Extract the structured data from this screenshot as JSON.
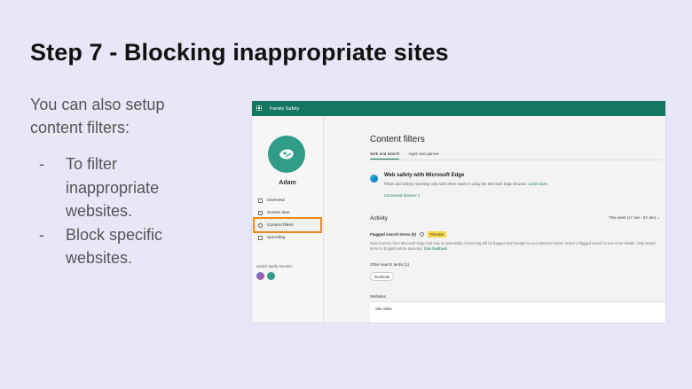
{
  "slide": {
    "title": "Step 7 - Blocking inappropriate sites",
    "intro": "You can also setup content filters:",
    "bullets": [
      {
        "dash": "-",
        "text": "To filter inappropriate websites."
      },
      {
        "dash": "-",
        "text": "Block specific websites."
      }
    ]
  },
  "app": {
    "title": "Family Safety",
    "accent_color": "#13785f",
    "highlight_color": "#f08a1a",
    "user": {
      "name": "Adam"
    },
    "nav": [
      {
        "label": "Overview",
        "icon": "overview-icon"
      },
      {
        "label": "Screen time",
        "icon": "screen-time-icon"
      },
      {
        "label": "Content filters",
        "icon": "content-filter-icon"
      },
      {
        "label": "Spending",
        "icon": "spending-icon"
      }
    ],
    "switch_label": "Switch family member"
  },
  "content": {
    "title": "Content filters",
    "tabs": [
      "Web and search",
      "Apps and games"
    ],
    "web_safety": {
      "title": "Web safety with Microsoft Edge",
      "desc": "Filters and activity reporting only work when Adam is using the Microsoft Edge browser.",
      "learn_more": "Learn more",
      "connected": "Connected devices: 1"
    },
    "activity": {
      "title": "Activity",
      "range": "This week (17 Jan - 23 Jan)",
      "flagged_label": "Flagged search terms (0)",
      "preview_badge": "Preview",
      "flagged_desc": "Search terms from Microsoft Edge that may be potentially concerning will be flagged and brought to your attention below. Select a flagged search to see more details. Only search terms in English will be detected.",
      "feedback": "Give feedback",
      "other_label": "Other search terms (1)",
      "other_chip": "facebook",
      "websites_label": "Websites",
      "site_visits": "Site visits"
    }
  }
}
